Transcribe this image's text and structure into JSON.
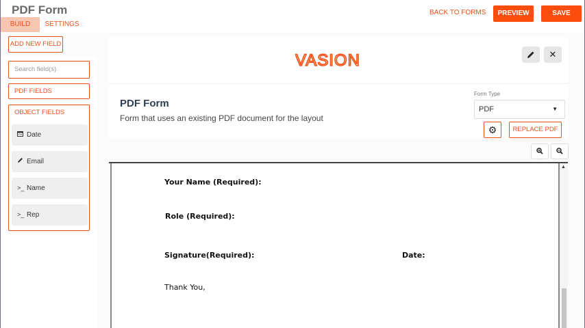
{
  "header": {
    "title": "PDF Form",
    "tabs": [
      {
        "label": "BUILD",
        "active": true
      },
      {
        "label": "SETTINGS",
        "active": false
      }
    ],
    "back_link": "BACK TO FORMS",
    "preview_label": "PREVIEW",
    "save_label": "SAVE"
  },
  "sidebar": {
    "add_field_label": "ADD NEW FIELD",
    "search_placeholder": "Search field(s)",
    "pdf_fields_label": "PDF FIELDS",
    "object_fields_label": "OBJECT FIELDS",
    "fields": [
      {
        "icon": "calendar-icon",
        "label": "Date"
      },
      {
        "icon": "pencil-icon",
        "label": "Email"
      },
      {
        "icon": "terminal-icon",
        "label": "Name"
      },
      {
        "icon": "terminal-icon",
        "label": "Rep"
      }
    ]
  },
  "form_card": {
    "logo_text": "VASION",
    "title": "PDF Form",
    "description": "Form that uses an existing PDF document for the layout",
    "form_type_label": "Form Type",
    "form_type_value": "PDF",
    "replace_pdf_label": "REPLACE PDF"
  },
  "pdf": {
    "lines": [
      {
        "text": "Your Name (Required):",
        "bold": true
      },
      {
        "text": "Role (Required):",
        "bold": true
      },
      {
        "text": "Signature(Required):",
        "bold": true
      },
      {
        "text": "Date:",
        "bold": true
      },
      {
        "text": "Thank You,",
        "bold": false
      }
    ]
  },
  "colors": {
    "accent": "#fa4d0e",
    "accent_text": "#e8501a",
    "tab_active_bg": "#f7c6b0",
    "title_text": "#2f3e50"
  }
}
